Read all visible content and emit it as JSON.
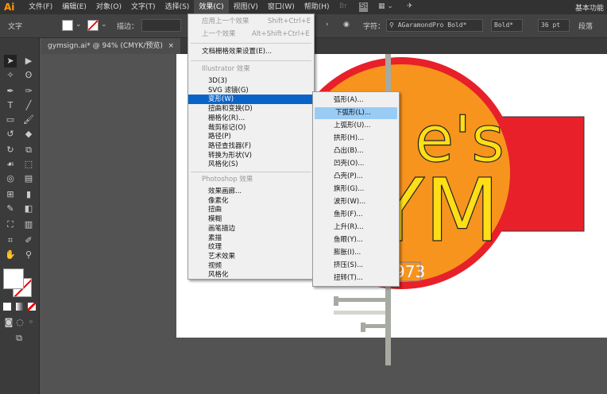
{
  "app": {
    "logo": "Ai",
    "workspace": "基本功能"
  },
  "menubar": [
    "文件(F)",
    "编辑(E)",
    "对象(O)",
    "文字(T)",
    "选择(S)",
    "效果(C)",
    "视图(V)",
    "窗口(W)",
    "帮助(H)"
  ],
  "menubar_icons": {
    "bridge": "Br",
    "stock": "St"
  },
  "control": {
    "label": "文字",
    "stroke_label": "描边：",
    "char_label": "字符：",
    "font": "AGaramondPro Bold*",
    "style": "Bold*",
    "size": "36 pt",
    "para_label": "段落"
  },
  "document_tab": {
    "title": "gymsign.ai* @ 94% (CMYK/预览)",
    "close": "×"
  },
  "effect_menu": {
    "apply_last": {
      "label": "应用上一个效果",
      "shortcut": "Shift+Ctrl+E"
    },
    "last": {
      "label": "上一个效果",
      "shortcut": "Alt+Shift+Ctrl+E"
    },
    "raster_settings": "文档栅格效果设置(E)...",
    "illustrator_header": "Illustrator 效果",
    "illustrator_items": [
      "3D(3)",
      "SVG 滤镜(G)",
      "变形(W)",
      "扭曲和变换(D)",
      "栅格化(R)...",
      "裁剪标记(O)",
      "路径(P)",
      "路径查找器(F)",
      "转换为形状(V)",
      "风格化(S)"
    ],
    "photoshop_header": "Photoshop 效果",
    "photoshop_items": [
      "效果画廊...",
      "像素化",
      "扭曲",
      "模糊",
      "画笔描边",
      "素描",
      "纹理",
      "艺术效果",
      "视频",
      "风格化"
    ]
  },
  "warp_submenu": [
    "弧形(A)...",
    "下弧形(L)...",
    "上弧形(U)...",
    "拱形(H)...",
    "凸出(B)...",
    "凹壳(O)...",
    "凸壳(P)...",
    "旗形(G)...",
    "波形(W)...",
    "鱼形(F)...",
    "上升(R)...",
    "鱼眼(Y)...",
    "膨胀(I)...",
    "挤压(S)...",
    "扭转(T)..."
  ],
  "artwork": {
    "text1": "e's",
    "text2": "YM",
    "year": "973"
  },
  "colors": {
    "accent": "#0a64c8",
    "hover": "#99ccf5",
    "red": "#e8202a",
    "orange": "#f7941d",
    "yellow": "#ffde17"
  }
}
